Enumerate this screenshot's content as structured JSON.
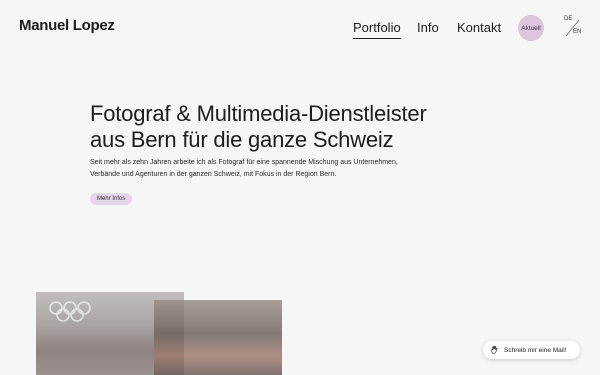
{
  "header": {
    "logo": "Manuel Lopez",
    "nav": [
      {
        "label": "Portfolio",
        "active": true
      },
      {
        "label": "Info",
        "active": false
      },
      {
        "label": "Kontakt",
        "active": false
      }
    ],
    "aktuell_label": "Aktuell",
    "lang": {
      "de": "DE",
      "en": "EN"
    }
  },
  "hero": {
    "title_line1": "Fotograf & Multimedia-Dienstleister",
    "title_line2": "aus Bern für die ganze Schweiz",
    "text_line1": "Seit mehr als zehn Jahren arbeite ich als Fotograf für eine spannende Mischung aus Unternehmen,",
    "text_line2": "Verbände und Agenturen in der ganzen Schweiz, mit Fokus in der Region Bern.",
    "button_label": "Mehr Infos"
  },
  "mail": {
    "label": "Schreib mir eine Mail!",
    "icon": "waving-hand-icon"
  },
  "colors": {
    "background": "#f7f6f6",
    "accent": "#dbc6de",
    "button_bg": "#e4d7e7",
    "text": "#1d1d1f"
  }
}
